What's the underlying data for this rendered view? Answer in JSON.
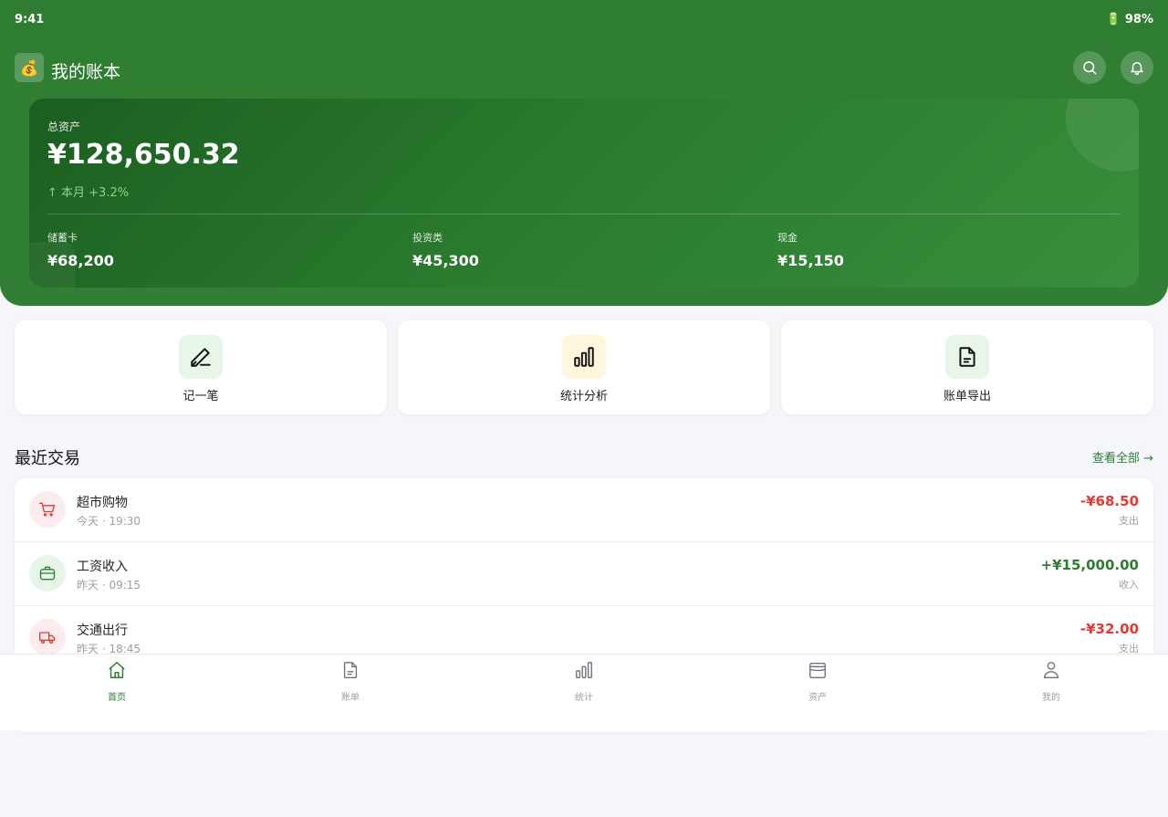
{
  "status_bar": {
    "time": "9:41",
    "battery": "🔋 98%"
  },
  "app": {
    "logo_glyph": "💰",
    "title": "我的账本"
  },
  "header_buttons": [
    {
      "icon": "search-icon"
    },
    {
      "icon": "bell-icon"
    }
  ],
  "asset_card": {
    "label": "总资产",
    "total": "¥128,650.32",
    "change": "↑ 本月 +3.2%",
    "subs": [
      {
        "label": "储蓄卡",
        "value": "¥68,200"
      },
      {
        "label": "投资类",
        "value": "¥45,300"
      },
      {
        "label": "现金",
        "value": "¥15,150"
      }
    ]
  },
  "quick_actions": [
    {
      "label": "记一笔",
      "icon": "pencil-icon",
      "bg": "#e8f5e9"
    },
    {
      "label": "统计分析",
      "icon": "bar-chart-icon",
      "bg": "#fff6dd"
    },
    {
      "label": "账单导出",
      "icon": "document-icon",
      "bg": "#e8f5e9"
    }
  ],
  "recent": {
    "title": "最近交易",
    "view_all": "查看全部 →",
    "items": [
      {
        "title": "超市购物",
        "time": "今天 · 19:30",
        "amount": "-¥68.50",
        "type": "支出",
        "sign": "neg",
        "icon": "cart-icon",
        "icon_bg": "#fdecee"
      },
      {
        "title": "工资收入",
        "time": "昨天 · 09:15",
        "amount": "+¥15,000.00",
        "type": "收入",
        "sign": "pos",
        "icon": "briefcase-icon",
        "icon_bg": "#e8f5e9"
      },
      {
        "title": "交通出行",
        "time": "昨天 · 18:45",
        "amount": "-¥32.00",
        "type": "支出",
        "sign": "neg",
        "icon": "truck-icon",
        "icon_bg": "#fdecee"
      }
    ]
  },
  "bottom_nav": [
    {
      "label": "首页",
      "icon": "home-icon",
      "active": true
    },
    {
      "label": "账单",
      "icon": "bill-icon",
      "active": false
    },
    {
      "label": "统计",
      "icon": "chart-icon",
      "active": false
    },
    {
      "label": "资产",
      "icon": "wallet-icon",
      "active": false
    },
    {
      "label": "我的",
      "icon": "user-icon",
      "active": false
    }
  ],
  "colors": {
    "primary": "#2e7d32",
    "expense": "#e53935",
    "income": "#2e7d32"
  }
}
